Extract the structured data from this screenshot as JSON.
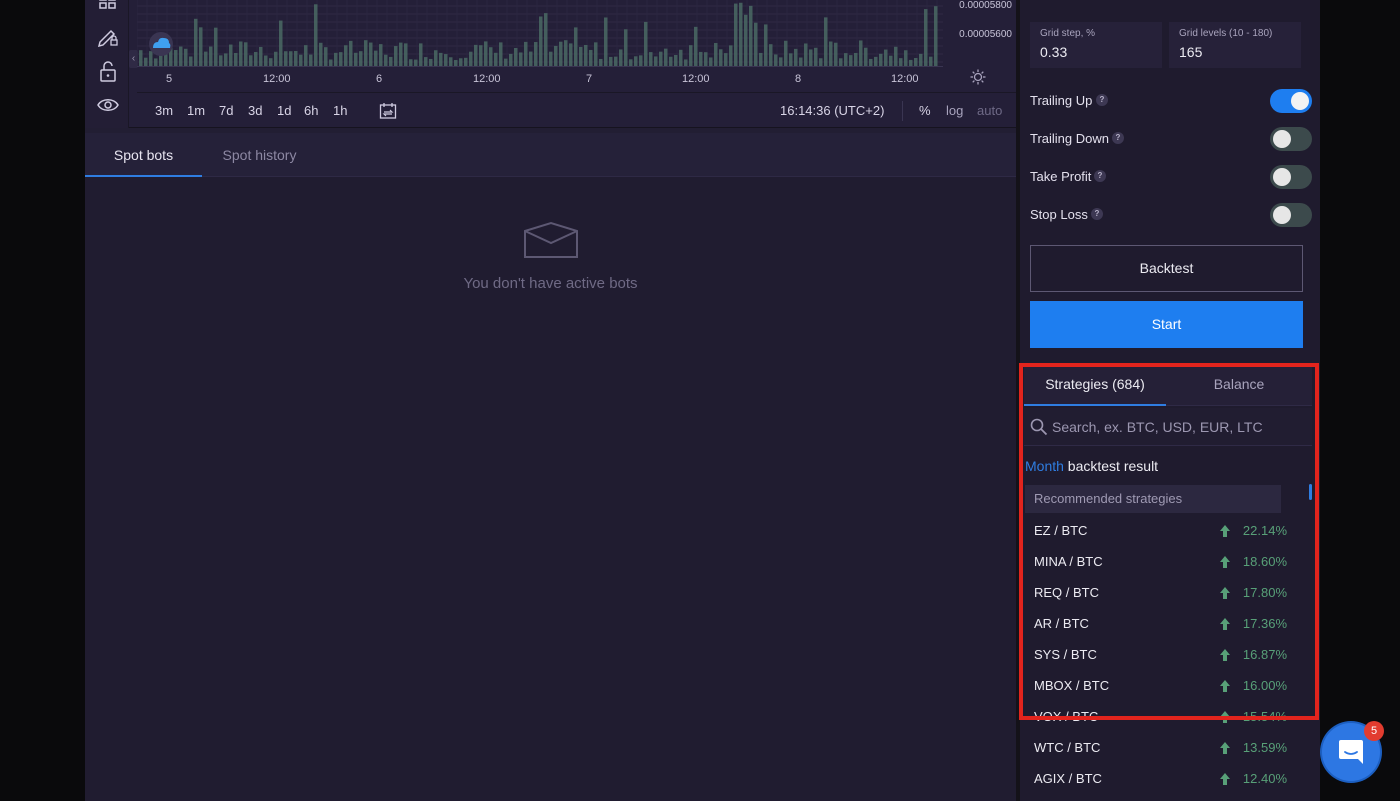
{
  "chart": {
    "price_labels": [
      "0.00005800",
      "0.00005600"
    ],
    "time_labels": [
      "5",
      "12:00",
      "6",
      "12:00",
      "7",
      "12:00",
      "8",
      "12:00"
    ],
    "range_buttons": [
      "3m",
      "1m",
      "7d",
      "3d",
      "1d",
      "6h",
      "1h"
    ],
    "clock": "16:14:36 (UTC+2)",
    "pct": "%",
    "log": "log",
    "auto": "auto",
    "collapse_glyph": "‹"
  },
  "tools": {
    "icons": [
      "grid-icon",
      "pencil-lock-icon",
      "unlock-icon",
      "eye-icon"
    ]
  },
  "bots": {
    "tab_spot_bots": "Spot bots",
    "tab_spot_history": "Spot history",
    "empty_text": "You don't have active bots"
  },
  "settings": {
    "grid_step_label": "Grid step, %",
    "grid_step_value": "0.33",
    "grid_levels_label": "Grid levels (10 - 180)",
    "grid_levels_value": "165",
    "toggles": [
      {
        "label": "Trailing Up",
        "on": true
      },
      {
        "label": "Trailing Down",
        "on": false
      },
      {
        "label": "Take Profit",
        "on": false
      },
      {
        "label": "Stop Loss",
        "on": false
      }
    ],
    "help_glyph": "?",
    "backtest": "Backtest",
    "start": "Start"
  },
  "strategies": {
    "tab_strategies": "Strategies (684)",
    "tab_balance": "Balance",
    "search_placeholder": "Search, ex. BTC, USD, EUR, LTC",
    "result_period": "Month",
    "result_text": " backtest result",
    "recommended_header": "Recommended strategies",
    "items": [
      {
        "pair": "EZ / BTC",
        "pct": "22.14%"
      },
      {
        "pair": "MINA / BTC",
        "pct": "18.60%"
      },
      {
        "pair": "REQ / BTC",
        "pct": "17.80%"
      },
      {
        "pair": "AR / BTC",
        "pct": "17.36%"
      },
      {
        "pair": "SYS / BTC",
        "pct": "16.87%"
      },
      {
        "pair": "MBOX / BTC",
        "pct": "16.00%"
      },
      {
        "pair": "VOX / BTC",
        "pct": "15.54%"
      },
      {
        "pair": "WTC / BTC",
        "pct": "13.59%"
      },
      {
        "pair": "AGIX / BTC",
        "pct": "12.40%"
      }
    ]
  },
  "chat": {
    "badge": "5"
  },
  "colors": {
    "accent": "#1e7ef0",
    "highlight": "#e2241d",
    "positive": "#58a078"
  }
}
